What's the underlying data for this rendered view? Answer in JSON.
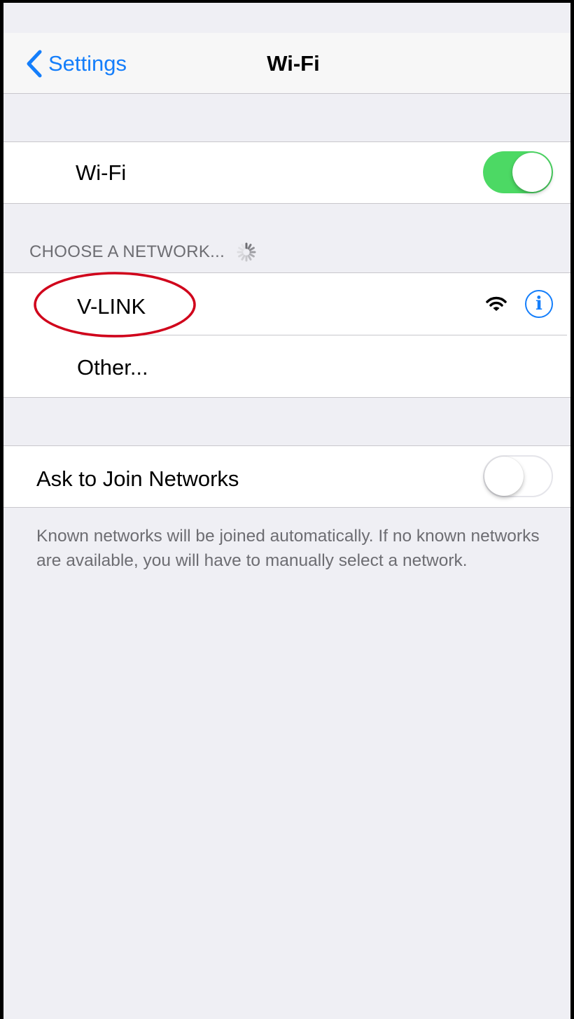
{
  "navbar": {
    "back_label": "Settings",
    "title": "Wi-Fi"
  },
  "wifi_toggle": {
    "label": "Wi-Fi",
    "state": "on"
  },
  "network_section": {
    "header": "CHOOSE A NETWORK...",
    "networks": [
      {
        "name": "V-LINK",
        "signal_icon": "wifi-full-icon",
        "info_icon": "info-icon",
        "highlighted": true
      },
      {
        "name": "Other..."
      }
    ]
  },
  "ask_to_join": {
    "label": "Ask to Join Networks",
    "state": "off",
    "note": "Known networks will be joined automatically. If no known networks are available, you will have to manually select a network."
  },
  "colors": {
    "accent": "#147efb",
    "switch_on": "#4cd964",
    "background": "#efeff4",
    "annotation": "#d0021b"
  }
}
